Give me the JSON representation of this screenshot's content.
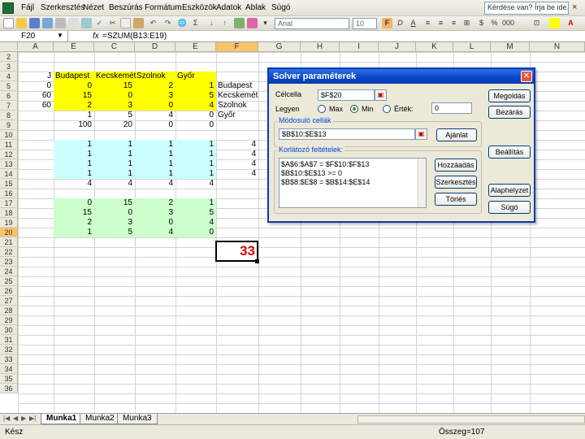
{
  "menu": {
    "items": [
      "Fájl",
      "Szerkesztés",
      "Nézet",
      "Beszúrás",
      "Formátum",
      "Eszközök",
      "Adatok",
      "Ablak",
      "Súgó"
    ],
    "help_placeholder": "Kérdése van? Írja be ide."
  },
  "toolbar": {
    "font_name": "Arial",
    "font_size": "10"
  },
  "formula_bar": {
    "cell_ref": "F20",
    "fx": "fx",
    "formula": "=SZUM(B13:E19)"
  },
  "grid": {
    "columns": [
      "A",
      "E",
      "C",
      "D",
      "E",
      "F",
      "G",
      "H",
      "I",
      "J",
      "K",
      "L",
      "M",
      "N"
    ],
    "rows": [
      "2",
      "3",
      "4",
      "5",
      "6",
      "7",
      "8",
      "9",
      "10",
      "11",
      "12",
      "13",
      "14",
      "15",
      "16",
      "17",
      "18",
      "19",
      "20",
      "21",
      "22",
      "23",
      "24",
      "25",
      "26",
      "27",
      "28",
      "29",
      "30",
      "31",
      "32",
      "33",
      "34",
      "35",
      "36"
    ],
    "header_row": [
      "Budapest",
      "Kecskemét",
      "Szolnok",
      "Győr"
    ],
    "col_a_values": [
      "J",
      "0",
      "60",
      "60"
    ],
    "yellow_block": [
      [
        "0",
        "15",
        "2",
        "1"
      ],
      [
        "15",
        "0",
        "3",
        "5"
      ],
      [
        "2",
        "3",
        "0",
        "4"
      ],
      [
        "1",
        "5",
        "4",
        "0"
      ]
    ],
    "yellow_labels": [
      "Budapest",
      "Kecskemét",
      "Szolnok",
      "Győr"
    ],
    "row8_values": [
      "100",
      "20",
      "0",
      "0"
    ],
    "cyan_block": [
      [
        "1",
        "1",
        "1",
        "1"
      ],
      [
        "1",
        "1",
        "1",
        "1"
      ],
      [
        "1",
        "1",
        "1",
        "1"
      ],
      [
        "1",
        "1",
        "1",
        "1"
      ]
    ],
    "cyan_right": [
      "4",
      "4",
      "4",
      "4"
    ],
    "row14_values": [
      "4",
      "4",
      "4",
      "4"
    ],
    "green_block": [
      [
        "0",
        "15",
        "2",
        "1"
      ],
      [
        "15",
        "0",
        "3",
        "5"
      ],
      [
        "2",
        "3",
        "0",
        "4"
      ],
      [
        "1",
        "5",
        "4",
        "0"
      ]
    ],
    "result": "33",
    "colors": {
      "yellow": "#ffff00",
      "cyan": "#ccffff",
      "green": "#ccffcc",
      "result": "#e00000"
    }
  },
  "sheets": {
    "tabs": [
      "Munka1",
      "Munka2",
      "Munka3"
    ],
    "active": "Munka1"
  },
  "status": {
    "ready": "Kész",
    "sum": "Összeg=107"
  },
  "solver": {
    "title": "Solver paraméterek",
    "target_label": "Célcella",
    "target_value": "$F$20",
    "equal_label": "Legyen",
    "opt_max": "Max",
    "opt_min": "Min",
    "opt_value": "Érték:",
    "value_field": "0",
    "changing_label": "Módosuló cellák",
    "changing_value": "$B$10:$E$13",
    "guess_button": "Ajánlat",
    "constraints_label": "Korlátozó feltételek:",
    "constraints": [
      "$A$6:$A$7 = $F$10:$F$13",
      "$B$10:$E$13 >= 0",
      "$B$8:$E$8 = $B$14:$E$14"
    ],
    "add_button": "Hozzáadás",
    "edit_button": "Szerkesztés",
    "delete_button": "Törlés",
    "solve_button": "Megoldás",
    "close_button": "Bezárás",
    "options_button": "Beállítás",
    "reset_button": "Alaphelyzet",
    "help_button": "Súgó"
  }
}
